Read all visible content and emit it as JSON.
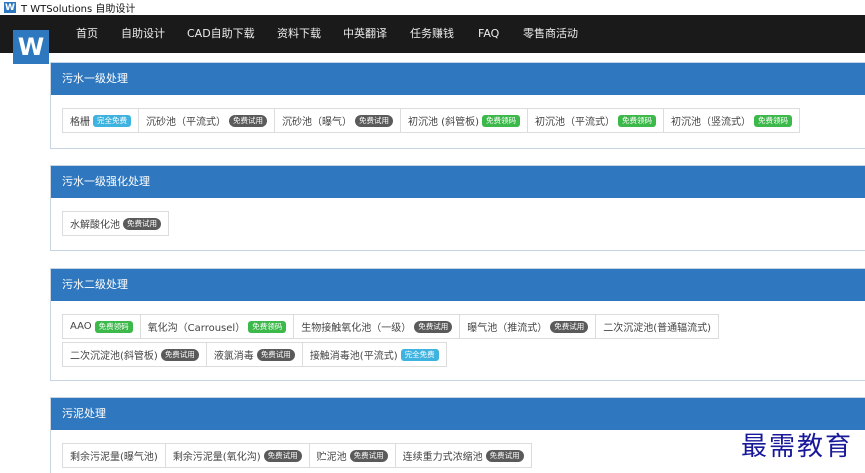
{
  "window": {
    "icon_letter": "W",
    "title": "T WTSolutions 自助设计"
  },
  "logo": {
    "letter": "W"
  },
  "nav": {
    "items": [
      "首页",
      "自助设计",
      "CAD自助下载",
      "资料下载",
      "中英翻译",
      "任务赚钱",
      "FAQ",
      "零售商活动"
    ]
  },
  "badges": {
    "trial": "免费试用",
    "free_download": "免费领码",
    "fully_free": "完全免费"
  },
  "sections": [
    {
      "title": "污水一级处理",
      "rows": [
        [
          {
            "label": "格栅",
            "badge": "完全免费",
            "type": "cyan"
          },
          {
            "label": "沉砂池（平流式）",
            "badge": "免费试用",
            "type": "trial"
          },
          {
            "label": "沉砂池（曝气）",
            "badge": "免费试用",
            "type": "trial"
          },
          {
            "label": "初沉池 (斜管板)",
            "badge": "免费领码",
            "type": "green"
          },
          {
            "label": "初沉池（平流式）",
            "badge": "免费领码",
            "type": "green"
          },
          {
            "label": "初沉池（竖流式）",
            "badge": "免费领码",
            "type": "green"
          }
        ]
      ]
    },
    {
      "title": "污水一级强化处理",
      "rows": [
        [
          {
            "label": "水解酸化池",
            "badge": "免费试用",
            "type": "trial"
          }
        ]
      ]
    },
    {
      "title": "污水二级处理",
      "rows": [
        [
          {
            "label": "AAO",
            "badge": "免费领码",
            "type": "green"
          },
          {
            "label": "氧化沟（Carrousel）",
            "badge": "免费领码",
            "type": "green"
          },
          {
            "label": "生物接触氧化池（一级）",
            "badge": "免费试用",
            "type": "trial"
          },
          {
            "label": "曝气池（推流式）",
            "badge": "免费试用",
            "type": "trial"
          },
          {
            "label": "二次沉淀池(普通辐流式)",
            "badge": "",
            "type": ""
          }
        ],
        [
          {
            "label": "二次沉淀池(斜管板)",
            "badge": "免费试用",
            "type": "trial"
          },
          {
            "label": "液氯消毒",
            "badge": "免费试用",
            "type": "trial"
          },
          {
            "label": "接触消毒池(平流式)",
            "badge": "完全免费",
            "type": "cyan"
          }
        ]
      ]
    },
    {
      "title": "污泥处理",
      "rows": [
        [
          {
            "label": "剩余污泥量(曝气池)",
            "badge": "",
            "type": ""
          },
          {
            "label": "剩余污泥量(氧化沟)",
            "badge": "免费试用",
            "type": "trial"
          },
          {
            "label": "贮泥池",
            "badge": "免费试用",
            "type": "trial"
          },
          {
            "label": "连续重力式浓缩池",
            "badge": "免费试用",
            "type": "trial"
          }
        ]
      ]
    }
  ],
  "watermark": "最需教育",
  "colors": {
    "brand": "#2f78bf",
    "navbar": "#1a1a1a",
    "trial": "#5a5a5a",
    "green": "#3db84a",
    "cyan": "#3fb3e0"
  }
}
